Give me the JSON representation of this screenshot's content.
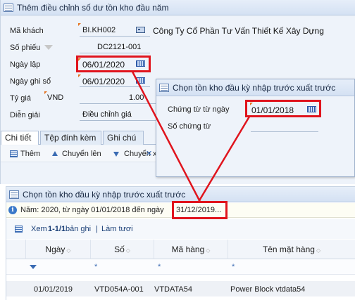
{
  "main_window": {
    "title": "Thêm điều chỉnh số dư tồn kho đầu năm",
    "fields": {
      "customer_label": "Mã khách",
      "customer_code": "BI.KH002",
      "customer_name": "Công Ty Cổ Phần Tư Vấn Thiết Kế Xây Dựng",
      "voucher_label": "Số phiếu",
      "voucher_no": "DC2121-001",
      "created_label": "Ngày lập",
      "created_date": "06/01/2020",
      "posted_label": "Ngày ghi sổ",
      "posted_date": "06/01/2020",
      "rate_label": "Tỷ giá",
      "currency": "VND",
      "rate_value": "1.00",
      "desc_label": "Diễn giải",
      "desc_value": "Điều chỉnh giá"
    },
    "tabs": [
      "Chi tiết",
      "Tệp đính kèm",
      "Ghi chú"
    ],
    "toolbar": {
      "add": "Thêm",
      "move_up": "Chuyển lên",
      "move_down": "Chuyển x"
    }
  },
  "popup": {
    "title": "Chọn tồn kho đầu kỳ nhập trước xuất trước",
    "from_label": "Chứng từ từ ngày",
    "from_value": "01/01/2018",
    "doc_no_label": "Số chứng từ"
  },
  "result_window": {
    "title": "Chọn tồn kho đầu kỳ nhập trước xuất trước",
    "info_prefix": "Năm: 2020, từ ngày 01/01/2018 đến ngày",
    "info_date": "31/12/2019...",
    "view_label": "Xem",
    "view_range": "1-1/1",
    "view_suffix": "bản ghi",
    "separator": "|",
    "refresh": "Làm tươi",
    "columns": [
      "Ngày",
      "Số",
      "Mã hàng",
      "Tên mặt hàng"
    ],
    "filter_star": "*",
    "rows": [
      {
        "date": "01/01/2019",
        "number": "VTD054A-001",
        "item_code": "VTDATA54",
        "item_name": "Power Block vtdata54"
      }
    ]
  },
  "colors": {
    "highlight": "#e0141d",
    "accent": "#3a6bb3",
    "window_bg": "#eef3fa"
  }
}
